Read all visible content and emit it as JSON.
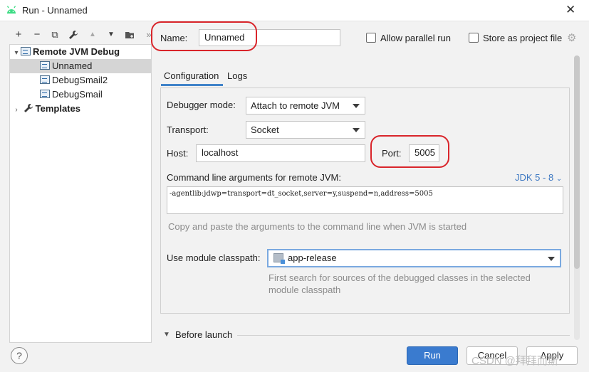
{
  "window": {
    "title": "Run - Unnamed",
    "close_glyph": "✕"
  },
  "toolbar": {
    "add": "+",
    "remove": "−",
    "copy": "⧉",
    "edit": "🔧",
    "up": "▲",
    "down": "▼",
    "folder": "▸",
    "more": "»"
  },
  "tree": {
    "root_label": "Remote JVM Debug",
    "items": [
      {
        "label": "Unnamed",
        "selected": true
      },
      {
        "label": "DebugSmail2",
        "selected": false
      },
      {
        "label": "DebugSmail",
        "selected": false
      }
    ],
    "templates_label": "Templates"
  },
  "name_field": {
    "label": "Name:",
    "value": "Unnamed"
  },
  "options": {
    "allow_parallel": "Allow parallel run",
    "store_as_file": "Store as project file"
  },
  "tabs": [
    {
      "label": "Configuration",
      "active": true
    },
    {
      "label": "Logs",
      "active": false
    }
  ],
  "config": {
    "debugger_mode_label": "Debugger mode:",
    "debugger_mode_value": "Attach to remote JVM",
    "transport_label": "Transport:",
    "transport_value": "Socket",
    "host_label": "Host:",
    "host_value": "localhost",
    "port_label": "Port:",
    "port_value": "5005",
    "cmd_label": "Command line arguments for remote JVM:",
    "jdk_link": "JDK 5 - 8",
    "cmd_value": "-agentlib:jdwp=transport=dt_socket,server=y,suspend=n,address=5005",
    "cmd_hint": "Copy and paste the arguments to the command line when JVM is started",
    "module_label": "Use module classpath:",
    "module_value": "app-release",
    "module_hint_1": "First search for sources of the debugged classes in the selected",
    "module_hint_2": "module classpath"
  },
  "before_launch": "Before launch",
  "buttons": {
    "help": "?",
    "run": "Run",
    "cancel": "Cancel",
    "apply": "Apply"
  },
  "watermark": "CSDN @拜拜而斯",
  "colors": {
    "accent": "#3a7bcf",
    "annotation": "#d9252b",
    "selection": "#d5d5d5"
  }
}
